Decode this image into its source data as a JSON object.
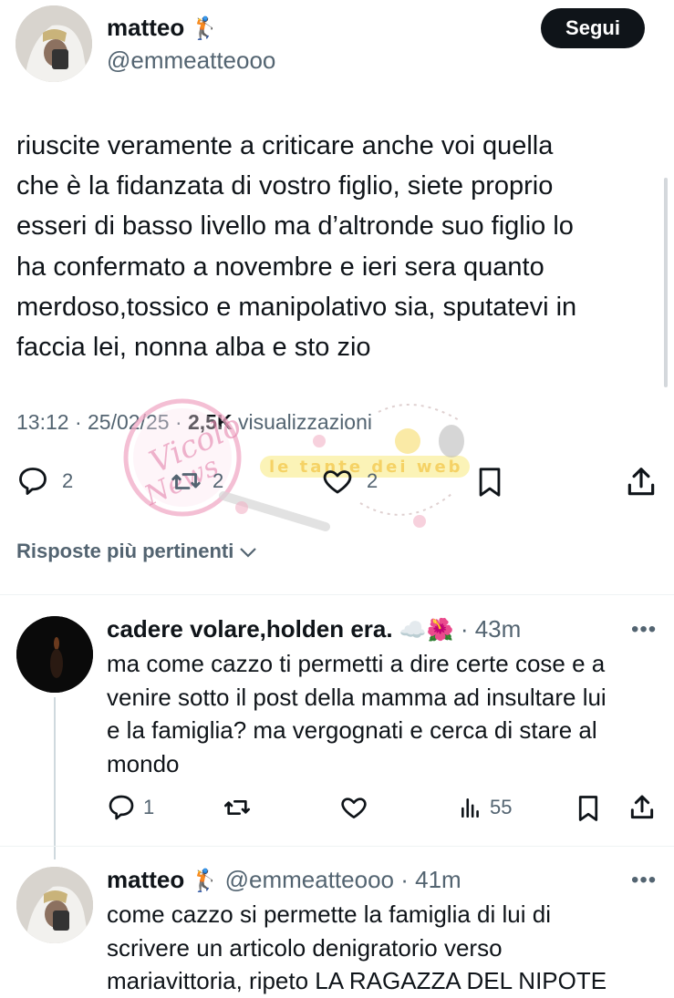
{
  "post": {
    "author_name": "matteo",
    "author_emoji": "🏌",
    "author_handle": "@emmeatteooo",
    "follow_label": "Segui",
    "text": "riuscite veramente a criticare anche voi quella\nche è la fidanzata di vostro figlio, siete proprio\nesseri di basso livello ma d’altronde suo figlio lo\nha confermato a novembre e ieri sera quanto\nmerdoso,tossico e manipolativo sia, sputatevi in\nfaccia lei, nonna alba e sto zio",
    "time": "13:12",
    "date": "25/02/25",
    "sep": "·",
    "views_count": "2,5K",
    "views_label": "visualizzazioni",
    "replies": "2",
    "reposts": "2",
    "likes": "2"
  },
  "sort_label": "Risposte più pertinenti",
  "watermark": {
    "stamp_text": "Vicolo delle News",
    "banner_text": "le tante dei web"
  },
  "replies": [
    {
      "name": "cadere volare,holden era.",
      "emojis": "☁️🌺",
      "time": "· 43m",
      "text": "ma come cazzo ti permetti a dire certe cose e a\nvenire sotto il post della mamma ad insultare lui\ne la famiglia? ma vergognati e cerca di stare al\nmondo",
      "replies": "1",
      "views": "55",
      "more": "•••"
    },
    {
      "name": "matteo",
      "emoji": "🏌",
      "handle": "@emmeatteooo",
      "time": "· 41m",
      "text": "come cazzo si permette la famiglia di lui di\nscrivere un articolo denigratorio verso\nmariavittoria, ripeto LA RAGAZZA DEL NIPOTE",
      "more": "•••"
    }
  ],
  "colors": {
    "text": "#0f1419",
    "secondary": "#536471",
    "divider": "#eff3f4",
    "button": "#0f1419"
  }
}
